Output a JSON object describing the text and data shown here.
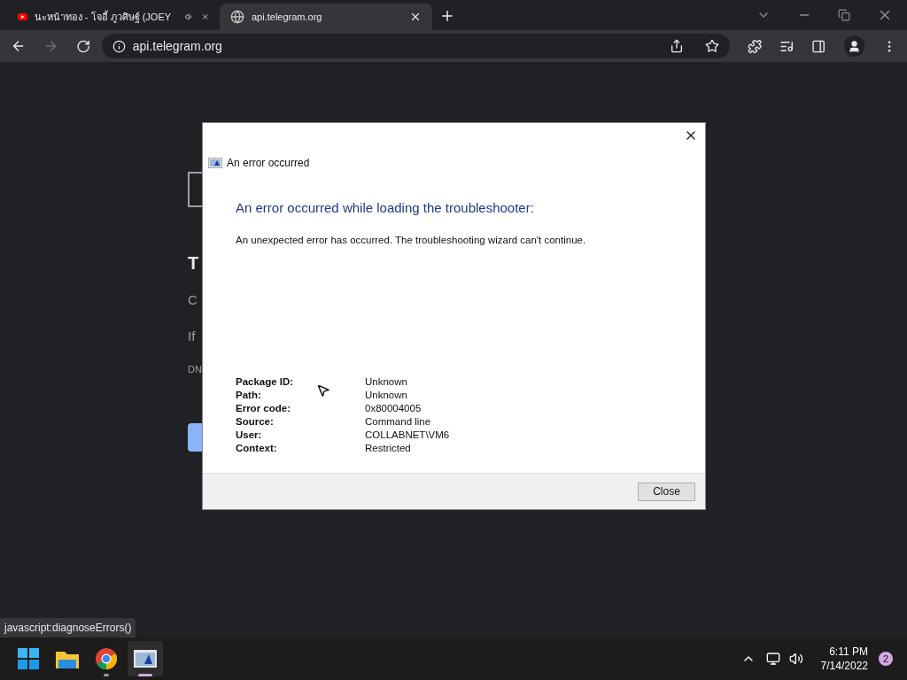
{
  "browser": {
    "tabs": [
      {
        "title": "นะหน้าทอง - โจอี้ ภูวศิษฐ์ (JOEY",
        "kind": "video",
        "audio": true,
        "selected": false
      },
      {
        "title": "api.telegram.org",
        "kind": "web",
        "audio": false,
        "selected": true
      }
    ],
    "address": "api.telegram.org",
    "forward_disabled": true
  },
  "page": {
    "fragments": [
      "T",
      "C",
      "If",
      "DN"
    ]
  },
  "dialog": {
    "caption": "An error occurred",
    "heading": "An error occurred while loading the troubleshooter:",
    "message": "An unexpected error has occurred. The troubleshooting wizard can't continue.",
    "details": [
      {
        "label": "Package ID:",
        "value": "Unknown"
      },
      {
        "label": "Path:",
        "value": "Unknown"
      },
      {
        "label": "Error code:",
        "value": "0x80004005"
      },
      {
        "label": "Source:",
        "value": "Command line"
      },
      {
        "label": "User:",
        "value": "COLLABNET\\VM6"
      },
      {
        "label": "Context:",
        "value": "Restricted"
      }
    ],
    "button": "Close"
  },
  "status_link": "javascript:diagnoseErrors()",
  "taskbar": {
    "apps": [
      {
        "kind": "start",
        "active": false
      },
      {
        "kind": "files",
        "active": false
      },
      {
        "kind": "chrome",
        "active": false,
        "running": true
      },
      {
        "kind": "troubleshooter",
        "active": true,
        "running": true
      }
    ],
    "time": "6:11 PM",
    "date": "7/14/2022",
    "notifications": "2"
  }
}
